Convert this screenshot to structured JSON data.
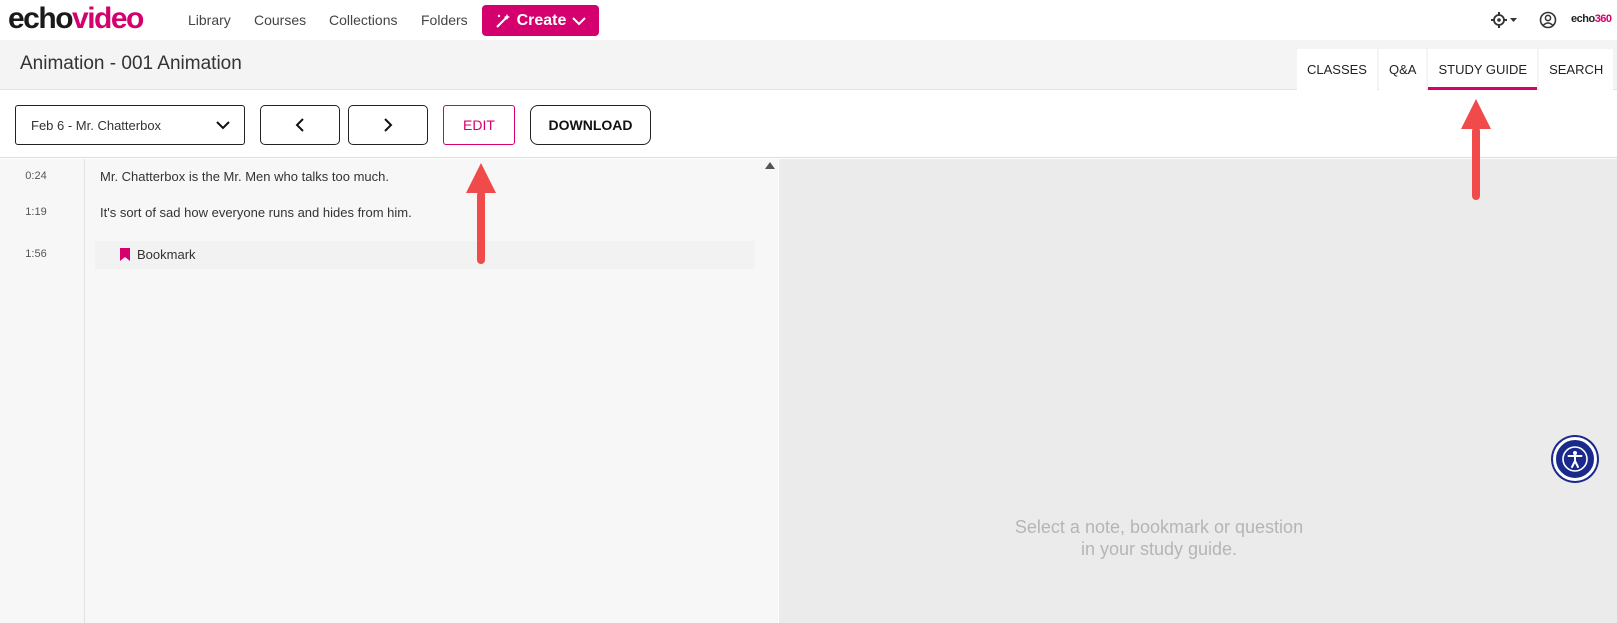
{
  "brand": {
    "logo_echo": "echo",
    "logo_video": "video",
    "vendor_echo": "echo",
    "vendor_num": "360"
  },
  "nav": {
    "items": [
      "Library",
      "Courses",
      "Collections",
      "Folders"
    ],
    "create_label": "Create"
  },
  "header": {
    "title": "Animation - 001 Animation",
    "tabs": [
      "CLASSES",
      "Q&A",
      "STUDY GUIDE",
      "SEARCH"
    ],
    "active_tab": "STUDY GUIDE"
  },
  "toolbar": {
    "class_select": "Feb 6 - Mr. Chatterbox",
    "edit_label": "EDIT",
    "download_label": "DOWNLOAD"
  },
  "transcript": {
    "rows": [
      {
        "time": "0:24",
        "text": "Mr. Chatterbox is the Mr. Men who talks too much."
      },
      {
        "time": "1:19",
        "text": "It's sort of sad how everyone runs and hides from him."
      }
    ],
    "bookmark": {
      "time": "1:56",
      "label": "Bookmark"
    }
  },
  "detail": {
    "empty_line1": "Select a note, bookmark or question",
    "empty_line2": "in your study guide."
  },
  "colors": {
    "brand": "#d4006d",
    "annotation_arrow": "#f04a4a",
    "a11y": "#1a2a8c"
  },
  "icons": [
    "create-wand-icon",
    "chevron-down-icon",
    "gear-icon",
    "user-icon",
    "chevron-left-icon",
    "chevron-right-icon",
    "bookmark-icon",
    "accessibility-icon",
    "scroll-up-icon"
  ]
}
